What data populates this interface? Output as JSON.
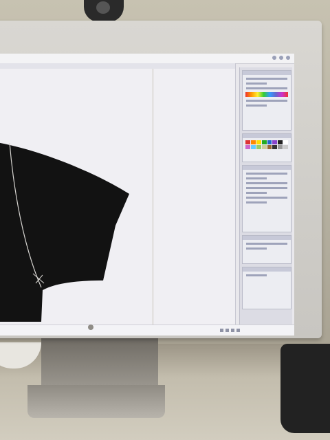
{
  "scene": {
    "description_items": [
      "monitor",
      "webcam",
      "desk",
      "stand"
    ]
  },
  "app": {
    "window_title": "",
    "panel_swatches": [
      "#d33",
      "#f80",
      "#fd0",
      "#2a2",
      "#26c",
      "#84c",
      "#222",
      "#fff",
      "#c6c",
      "#6cf",
      "#9c6",
      "#cc9",
      "#963",
      "#333",
      "#999",
      "#ccc"
    ]
  },
  "colors": {
    "shape_fill": "#121212",
    "shape_stroke": "#d8d6d2"
  }
}
